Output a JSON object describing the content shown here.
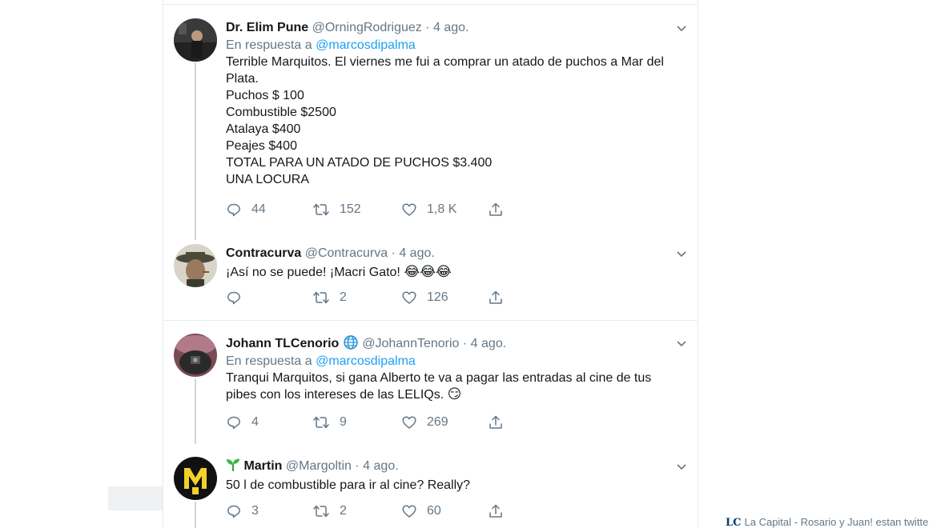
{
  "tweets": [
    {
      "name": "Dr. Elim Pune",
      "handle": "@OrningRodriguez",
      "date": "· 4 ago.",
      "reply_prefix": "En respuesta a",
      "reply_to": "@marcosdipalma",
      "lines": [
        "Terrible Marquitos. El viernes me fui a comprar un atado de puchos a Mar del",
        "Plata.",
        "Puchos $ 100",
        "Combustible $2500",
        "Atalaya $400",
        "Peajes $400",
        "TOTAL PARA UN ATADO DE PUCHOS $3.400",
        "UNA LOCURA"
      ],
      "replies": "44",
      "retweets": "152",
      "likes": "1,8 K"
    },
    {
      "name": "Contracurva",
      "handle": "@Contracurva",
      "date": "· 4 ago.",
      "text": "¡Así no se puede! ¡Macri Gato!",
      "emoji": "😂😂😂",
      "replies": "",
      "retweets": "2",
      "likes": "126"
    },
    {
      "name": "Johann TLCenorio",
      "badge_icon": "globe-icon",
      "handle": "@JohannTenorio",
      "date": "· 4 ago.",
      "reply_prefix": "En respuesta a",
      "reply_to": "@marcosdipalma",
      "lines": [
        "Tranqui Marquitos, si gana Alberto te va a pagar las entradas al cine de tus",
        "pibes con los intereses de las LELIQs."
      ],
      "emoji": "😏",
      "replies": "4",
      "retweets": "9",
      "likes": "269"
    },
    {
      "name": "Martin",
      "name_icon": "sprout-icon",
      "handle": "@Margoltin",
      "date": "· 4 ago.",
      "text": "50 l de combustible para ir al cine? Really?",
      "replies": "3",
      "retweets": "2",
      "likes": "60"
    }
  ],
  "footer_card": {
    "logo": "LC",
    "text": "La Capital - Rosario y Juan! estan twitte"
  },
  "colors": {
    "link": "#1da1f2",
    "muted": "#657786",
    "border": "#e6ecf0",
    "thread": "#ccd6dd"
  }
}
